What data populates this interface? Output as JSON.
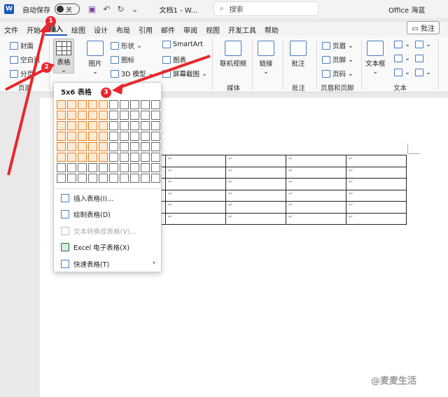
{
  "titlebar": {
    "logo": "W",
    "autosave_label": "自动保存",
    "autosave_toggle": "关",
    "doc_title": "文档1 - W...",
    "search_placeholder": "搜索",
    "user": "Office 海蓝",
    "icons": [
      "save-icon",
      "undo-icon",
      "redo-icon",
      "customize-icon"
    ]
  },
  "tabs": [
    "文件",
    "开始",
    "插入",
    "绘图",
    "设计",
    "布局",
    "引用",
    "邮件",
    "审阅",
    "视图",
    "开发工具",
    "帮助"
  ],
  "active_tab": "插入",
  "comment_button": "批注",
  "ribbon": {
    "cover": "封面",
    "blank_page": "空白页",
    "page_break": "分页",
    "group_pages": "页面",
    "table": "表格",
    "picture": "图片",
    "shapes": "形状",
    "icons": "图标",
    "model3d": "3D 模型",
    "smartart": "SmartArt",
    "chart": "图表",
    "screenshot": "屏幕截图",
    "online_video": "联机视频",
    "group_media": "媒体",
    "link": "链接",
    "comment": "批注",
    "group_comment": "批注",
    "header": "页眉",
    "footer": "页脚",
    "page_number": "页码",
    "group_header_footer": "页眉和页脚",
    "textbox": "文本框",
    "group_text": "文本"
  },
  "dropdown": {
    "title": "5x6 表格",
    "grid_cols": 10,
    "grid_rows": 8,
    "highlight_cols": 5,
    "highlight_rows": 6,
    "items": [
      {
        "label": "插入表格(I)...",
        "disabled": false
      },
      {
        "label": "绘制表格(D)",
        "disabled": false
      },
      {
        "label": "文本转换成表格(V)...",
        "disabled": true
      },
      {
        "label": "Excel 电子表格(X)",
        "disabled": false
      },
      {
        "label": "快速表格(T)",
        "disabled": false
      }
    ]
  },
  "annotations": {
    "badge1": "1",
    "badge2": "2",
    "badge3": "3"
  },
  "table": {
    "rows": 6,
    "cols": 5,
    "cell_mark": "↵"
  },
  "watermark": "@麦麦生活",
  "colors": {
    "accent": "#185abd",
    "highlight_border": "#e87d1e",
    "highlight_fill": "#fdebd3",
    "annotation": "#e8272d"
  }
}
